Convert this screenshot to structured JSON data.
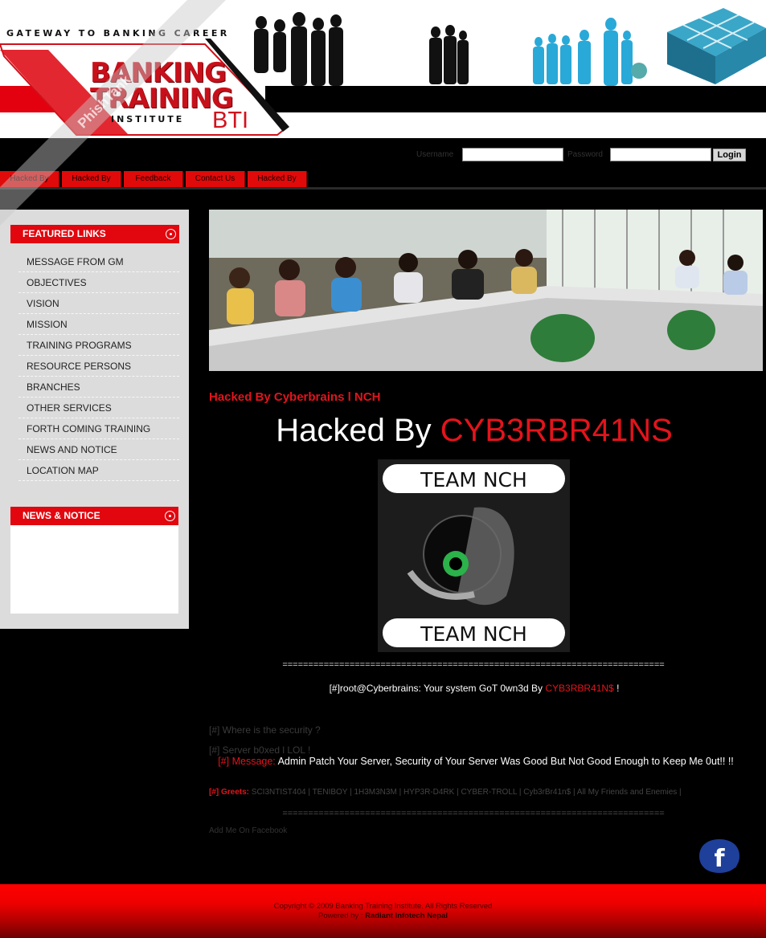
{
  "header": {
    "tagline": "GATEWAY TO BANKING CAREER",
    "logo_line1": "BANKING",
    "logo_line2": "TRAINING",
    "logo_sub": "INSTITUTE",
    "logo_abbr": "BTI"
  },
  "login": {
    "username_label": "Username",
    "password_label": "Password",
    "button": "Login"
  },
  "nav": [
    "Hacked By",
    "Hacked By",
    "Feedback",
    "Contact Us",
    "Hacked By"
  ],
  "sidebar": {
    "featured_title": "FEATURED LINKS",
    "links": [
      "MESSAGE FROM GM",
      "OBJECTIVES",
      "VISION",
      "MISSION",
      "TRAINING PROGRAMS",
      "RESOURCE PERSONS",
      "BRANCHES",
      "OTHER SERVICES",
      "FORTH COMING TRAINING",
      "NEWS AND NOTICE",
      "LOCATION MAP"
    ],
    "news_title": "NEWS & NOTICE"
  },
  "main": {
    "hacked_small": "Hacked By Cyberbrains l NCH",
    "hacked_big_prefix": "Hacked By ",
    "hacked_big_name": "CYB3RBR41NS",
    "team_logo_top": "TEAM NCH",
    "team_logo_bottom": "TEAM NCH",
    "rule": "==========================================================================",
    "root_prefix": "[#]root@Cyberbrains: Your system GoT 0wn3d By ",
    "root_name": "CYB3RBR41N$",
    "root_suffix": " !",
    "security_line": "[#] Where is the security ?",
    "boxed_line": "[#] Server b0xed l LOL !",
    "message_label": "[#] Message:",
    "message_text": " Admin Patch Your Server, Security of Your Server Was Good But Not Good Enough to Keep Me 0ut!! !!",
    "greets_label": "[#] Greets:",
    "greets_text": " SCI3NTIST404 | TENIBOY | 1H3M3N3M | HYP3R-D4RK | CYBER-TROLL | Cyb3rBr41n$ | All My Friends and Enemies |",
    "add_facebook": "Add Me On Facebook"
  },
  "footer": {
    "copyright": "Copyright © 2009 Banking Training Institute. All Rights Reserved",
    "powered_prefix": "Powered by : ",
    "powered_name": "Radiant Infotech Nepal"
  },
  "watermark": "PhishTank",
  "colors": {
    "accent_red": "#e3141c",
    "sidebar_bg": "#dcdcdc",
    "page_bg": "#000000"
  }
}
